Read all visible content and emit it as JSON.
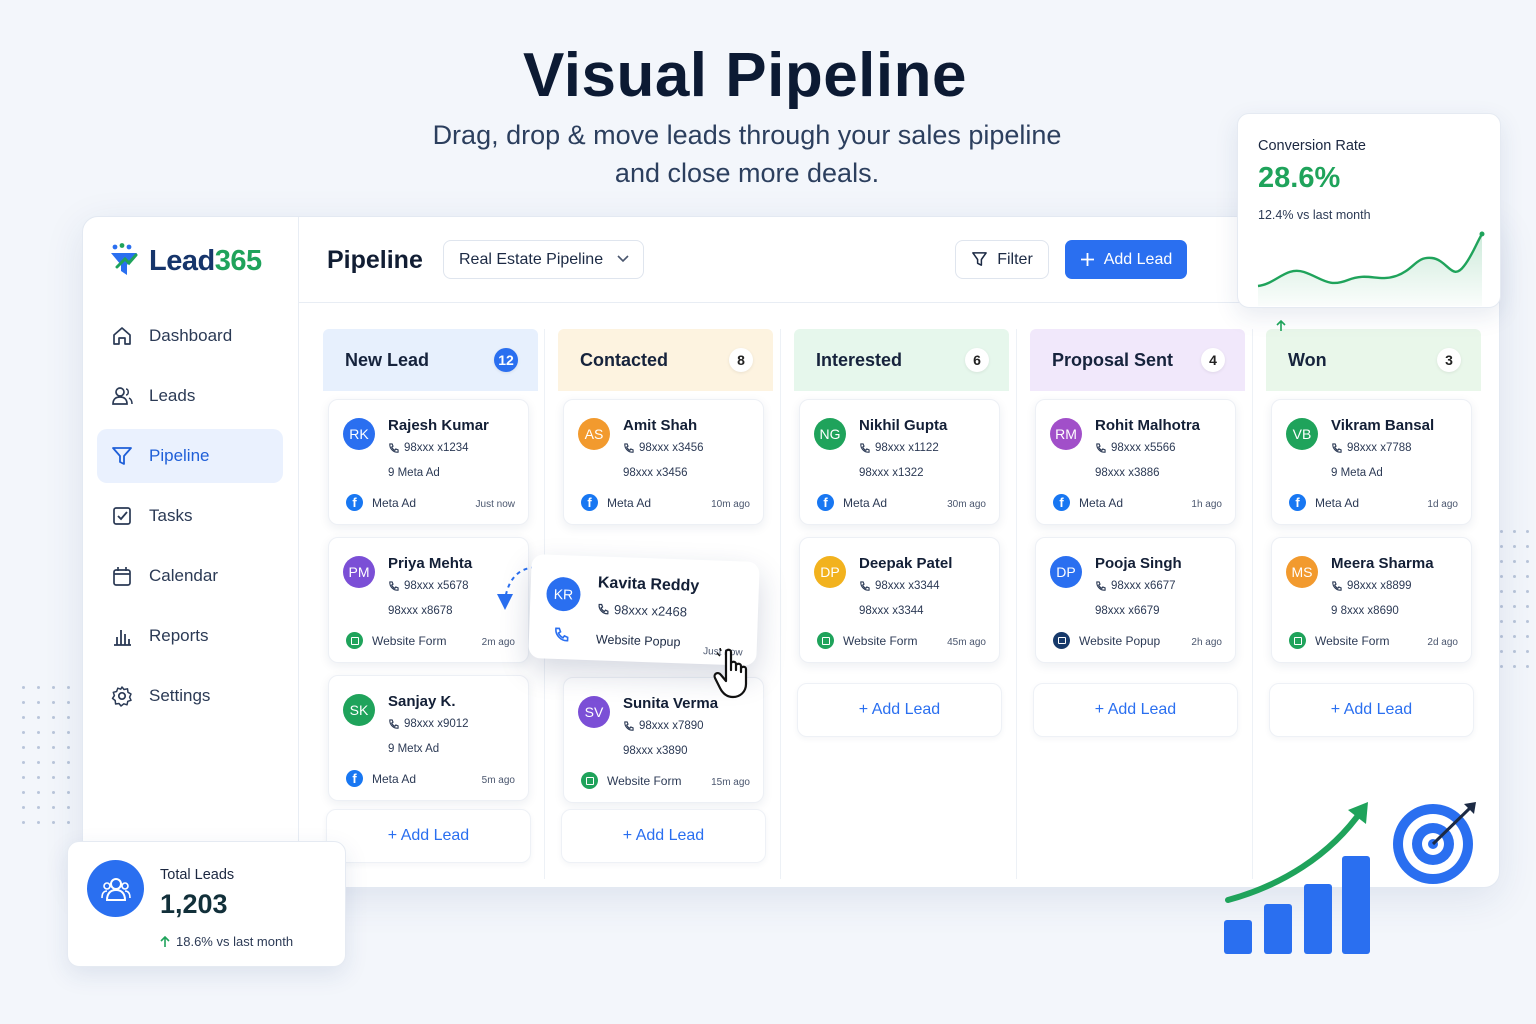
{
  "hero": {
    "title": "Visual Pipeline",
    "subtitle_line1": "Drag, drop & move leads through your sales pipeline",
    "subtitle_line2": "and close more deals."
  },
  "brand": {
    "name": "Lead",
    "name_num": "365",
    "color": "#16356b",
    "accent": "#1fa35b"
  },
  "sidebar": {
    "items": [
      {
        "label": "Dashboard",
        "icon": "home-icon"
      },
      {
        "label": "Leads",
        "icon": "users-icon"
      },
      {
        "label": "Pipeline",
        "icon": "funnel-icon",
        "active": true
      },
      {
        "label": "Tasks",
        "icon": "checkbox-icon"
      },
      {
        "label": "Calendar",
        "icon": "calendar-icon"
      },
      {
        "label": "Reports",
        "icon": "bar-chart-icon"
      },
      {
        "label": "Settings",
        "icon": "gear-icon"
      }
    ]
  },
  "topbar": {
    "title": "Pipeline",
    "pipeline_select": "Real Estate Pipeline",
    "filter_label": "Filter",
    "add_lead_label": "Add Lead"
  },
  "columns": [
    {
      "name": "New Lead",
      "count": "12",
      "color": "#e7f0fd",
      "cards": [
        {
          "initials": "RK",
          "name": "Rajesh Kumar",
          "phone": "98xxx x1234",
          "extra": "9 Meta Ad",
          "source": "Meta Ad",
          "source_type": "meta",
          "time": "Just now",
          "avatar_color": "#2a6ff0"
        },
        {
          "initials": "PM",
          "name": "Priya Mehta",
          "phone": "98xxx x5678",
          "extra": "98xxx x8678",
          "source": "Website Form",
          "source_type": "form",
          "time": "2m ago",
          "avatar_color": "#7b4fd6"
        },
        {
          "initials": "SK",
          "name": "Sanjay K.",
          "phone": "98xxx x9012",
          "extra": "9 Metx Ad",
          "source": "Meta Ad",
          "source_type": "meta",
          "time": "5m ago",
          "avatar_color": "#1fa35b"
        }
      ],
      "add_label": "+ Add Lead"
    },
    {
      "name": "Contacted",
      "count": "8",
      "color": "#fdf3e0",
      "cards": [
        {
          "initials": "AS",
          "name": "Amit Shah",
          "phone": "98xxx x3456",
          "extra": "98xxx x3456",
          "source": "Meta Ad",
          "source_type": "meta",
          "time": "10m ago",
          "avatar_color": "#f29a2e"
        },
        {
          "initials": "SV",
          "name": "Sunita Verma",
          "phone": "98xxx x7890",
          "extra": "98xxx x3890",
          "source": "Website Form",
          "source_type": "form",
          "time": "15m ago",
          "avatar_color": "#7b4fd6"
        }
      ],
      "add_label": "+ Add Lead"
    },
    {
      "name": "Interested",
      "count": "6",
      "color": "#e6f7ec",
      "cards": [
        {
          "initials": "NG",
          "name": "Nikhil Gupta",
          "phone": "98xxx x1122",
          "extra": "98xxx x1322",
          "source": "Meta Ad",
          "source_type": "meta",
          "time": "30m ago",
          "avatar_color": "#1fa35b"
        },
        {
          "initials": "DP",
          "name": "Deepak Patel",
          "phone": "98xxx x3344",
          "extra": "98xxx x3344",
          "source": "Website Form",
          "source_type": "form",
          "time": "45m ago",
          "avatar_color": "#f2b21e"
        }
      ],
      "add_label": "+ Add Lead"
    },
    {
      "name": "Proposal Sent",
      "count": "4",
      "color": "#f1e8fb",
      "cards": [
        {
          "initials": "RM",
          "name": "Rohit Malhotra",
          "phone": "98xxx x5566",
          "extra": "98xxx x3886",
          "source": "Meta Ad",
          "source_type": "meta",
          "time": "1h ago",
          "avatar_color": "#a14fc9"
        },
        {
          "initials": "DP",
          "name": "Pooja Singh",
          "phone": "98xxx x6677",
          "extra": "98xxx x6679",
          "source": "Website Popup",
          "source_type": "popup",
          "time": "2h ago",
          "avatar_color": "#2a6ff0"
        }
      ],
      "add_label": "+ Add Lead"
    },
    {
      "name": "Won",
      "count": "3",
      "color": "#e9f7ea",
      "cards": [
        {
          "initials": "VB",
          "name": "Vikram Bansal",
          "phone": "98xxx x7788",
          "extra": "9 Meta Ad",
          "source": "Meta Ad",
          "source_type": "meta",
          "time": "1d ago",
          "avatar_color": "#1fa35b"
        },
        {
          "initials": "MS",
          "name": "Meera Sharma",
          "phone": "98xxx x8899",
          "extra": "9 8xxx x8690",
          "source": "Website Form",
          "source_type": "form",
          "time": "2d ago",
          "avatar_color": "#f29a2e"
        }
      ],
      "add_label": "+ Add Lead"
    }
  ],
  "dragged_card": {
    "initials": "KR",
    "name": "Kavita Reddy",
    "phone": "98xxx x2468",
    "source": "Website Popup",
    "time": "Just now",
    "avatar_color": "#2a6ff0"
  },
  "conversion": {
    "title": "Conversion Rate",
    "value": "28.6%",
    "delta": "12.4% vs last month",
    "color": "#1fa35b"
  },
  "total_leads": {
    "title": "Total Leads",
    "value": "1,203",
    "delta": "18.6% vs last month"
  }
}
